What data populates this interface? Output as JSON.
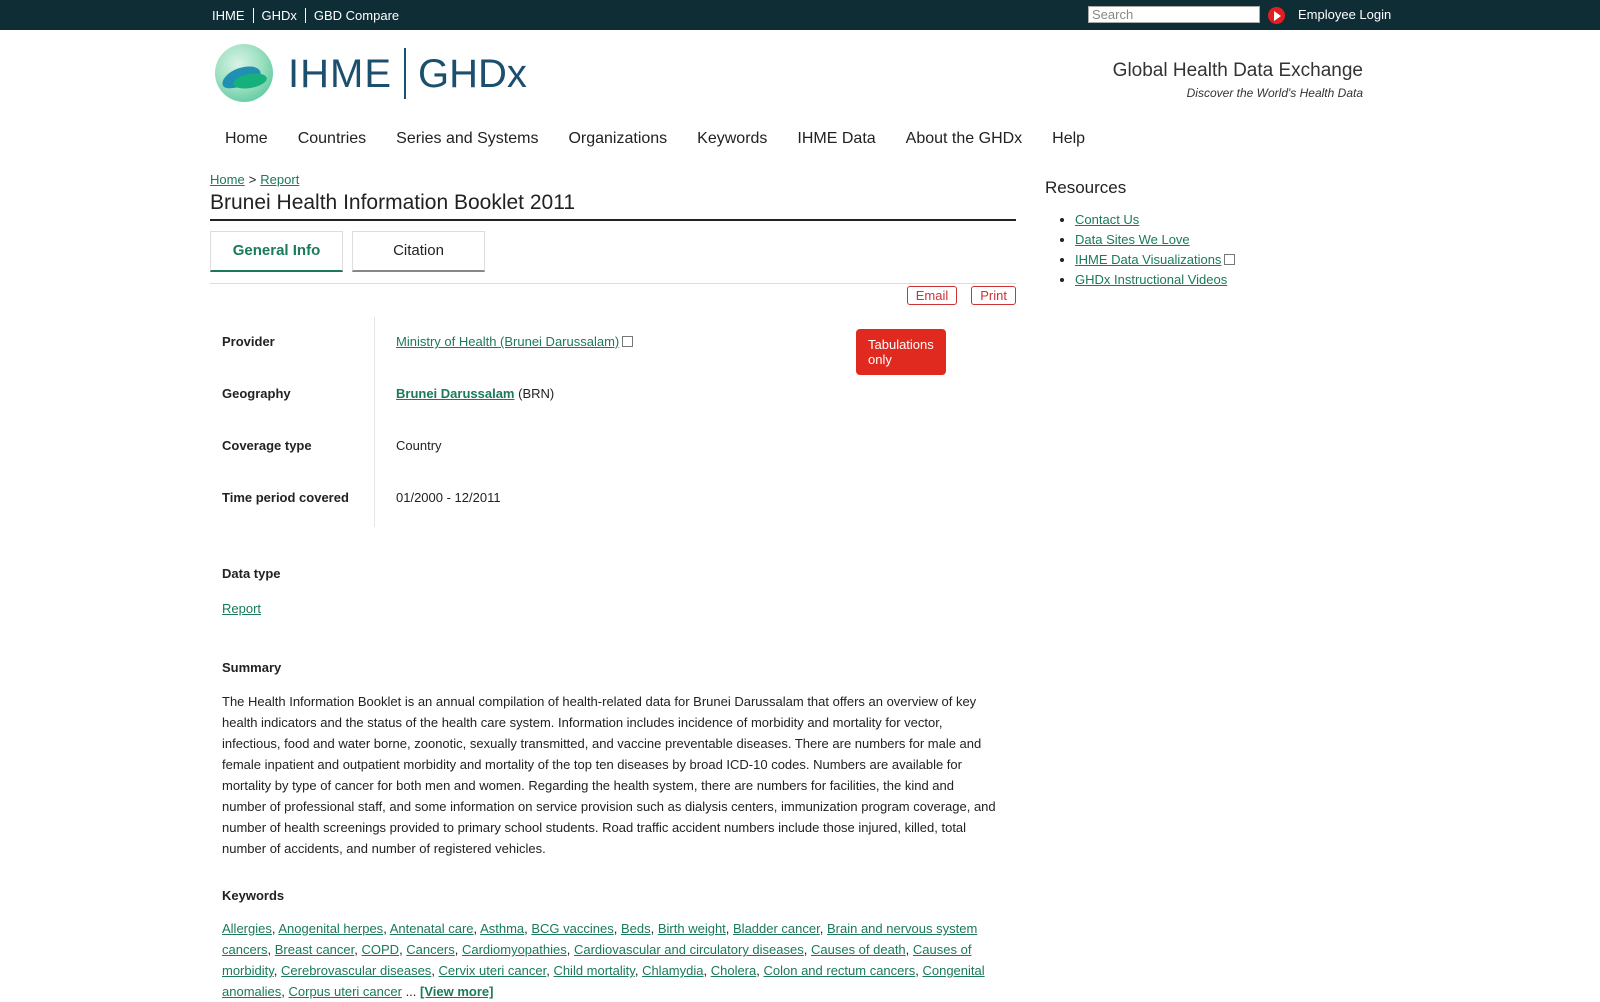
{
  "topbar": {
    "links": [
      "IHME",
      "GHDx",
      "GBD Compare"
    ],
    "search_placeholder": "Search",
    "login_label": "Employee Login"
  },
  "header": {
    "logo_ihme": "IHME",
    "logo_ghdx": "GHDx",
    "tagline_title": "Global Health Data Exchange",
    "tagline_sub": "Discover the World's Health Data"
  },
  "nav": [
    "Home",
    "Countries",
    "Series and Systems",
    "Organizations",
    "Keywords",
    "IHME Data",
    "About the GHDx",
    "Help"
  ],
  "breadcrumb": {
    "home": "Home",
    "sep": ">",
    "current": "Report"
  },
  "page_title": "Brunei Health Information Booklet 2011",
  "tabs": {
    "general": "General Info",
    "citation": "Citation"
  },
  "actions": {
    "email": "Email",
    "print": "Print"
  },
  "info": {
    "provider_label": "Provider",
    "provider_value": "Ministry of Health (Brunei Darussalam)",
    "provider_badge": "Tabulations only",
    "geography_label": "Geography",
    "geography_value": "Brunei Darussalam",
    "geography_code": "(BRN)",
    "coverage_label": "Coverage type",
    "coverage_value": "Country",
    "time_label": "Time period covered",
    "time_value": "01/2000 - 12/2011"
  },
  "data_type": {
    "label": "Data type",
    "value": "Report"
  },
  "summary": {
    "label": "Summary",
    "text": "The Health Information Booklet is an annual compilation of health-related data for Brunei Darussalam that offers an overview of key health indicators and the status of the health care system. Information includes incidence of morbidity and mortality for vector, infectious, food and water borne, zoonotic, sexually transmitted, and vaccine preventable diseases. There are numbers for male and female inpatient and outpatient morbidity and mortality of the top ten diseases by broad ICD-10 codes. Numbers are available for mortality by type of cancer for both men and women. Regarding the health system, there are numbers for facilities, the kind and number of professional staff, and some information on service provision such as dialysis centers, immunization program coverage, and number of health screenings provided to primary school students. Road traffic accident numbers include those injured, killed, total number of accidents, and number of registered vehicles."
  },
  "keywords": {
    "label": "Keywords",
    "items": [
      "Allergies",
      "Anogenital herpes",
      "Antenatal care",
      "Asthma",
      "BCG vaccines",
      "Beds",
      "Birth weight",
      "Bladder cancer",
      "Brain and nervous system cancers",
      "Breast cancer",
      "COPD",
      "Cancers",
      "Cardiomyopathies",
      "Cardiovascular and circulatory diseases",
      "Causes of death",
      "Causes of morbidity",
      "Cerebrovascular diseases",
      "Cervix uteri cancer",
      "Child mortality",
      "Chlamydia",
      "Cholera",
      "Colon and rectum cancers",
      "Congenital anomalies",
      "Corpus uteri cancer"
    ],
    "ellipsis": "...",
    "view_more": "[View more]"
  },
  "sidebar": {
    "title": "Resources",
    "links": [
      "Contact Us",
      "Data Sites We Love",
      "IHME Data Visualizations",
      "GHDx Instructional Videos"
    ]
  }
}
